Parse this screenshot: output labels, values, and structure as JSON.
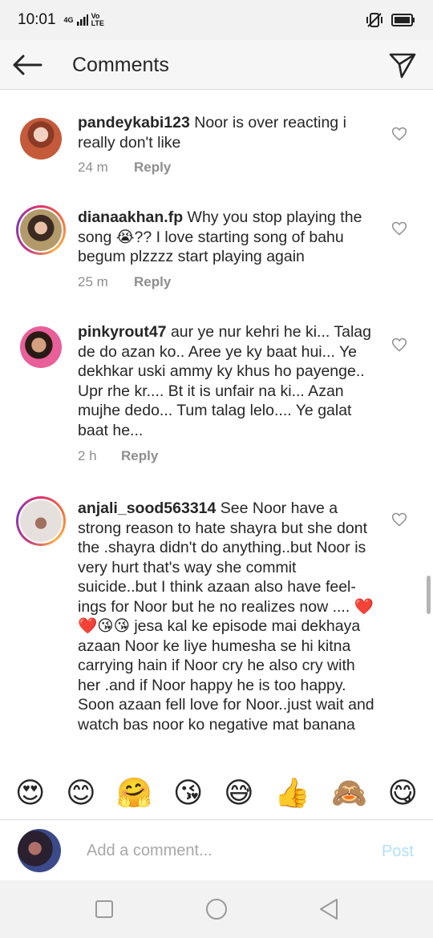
{
  "status_bar": {
    "time": "10:01",
    "network_top": "4G",
    "network_bottom": "Vo",
    "network_lte": "LTE"
  },
  "header": {
    "title": "Comments"
  },
  "comments": [
    {
      "username": "pandeykabi123",
      "text": " Noor is over reacting i really don't like",
      "time": "24 m",
      "reply": "Reply"
    },
    {
      "username": "dianaakhan.fp",
      "text": " Why you stop playing the song 😭?? I love starting song of bahu begum plzzzz start playing again",
      "time": "25 m",
      "reply": "Reply"
    },
    {
      "username": "pinkyrout47",
      "text": " aur ye nur kehri he ki... Talag de do azan ko.. Aree ye ky baat hui... Ye dekhkar uski ammy ky khus ho payenge.. Upr rhe kr.... Bt it is unfair na ki... Azan mujhe dedo... Tum talag lelo.... Ye galat baat he...",
      "time": "2 h",
      "reply": "Reply"
    },
    {
      "username": "anjali_sood563314",
      "text": " See Noor have a strong  reason  to hate shayra but she dont the .shayra didn't do anything..but Noor is very hurt that's way she commit suicide..but I think azaan also have feel-ings for Noor but he no realizes now .... ❤️❤️😘😘 jesa kal  ke episode mai dekhaya azaan Noor ke liye humesha se hi kitna carrying hain if Noor cry he also cry with  her .and if Noor happy he is too happy. Soon azaan fell love for Noor..just wait and watch bas noor ko negative mat banana",
      "time": "",
      "reply": ""
    }
  ],
  "emoji_bar": [
    "😍",
    "😊",
    "🤗",
    "😘",
    "😅",
    "👍",
    "🙈",
    "😋"
  ],
  "composer": {
    "placeholder": "Add a comment...",
    "post_label": "Post"
  },
  "icons": {
    "back": "back-arrow-icon",
    "send": "direct-send-icon",
    "like": "heart-outline-icon"
  }
}
